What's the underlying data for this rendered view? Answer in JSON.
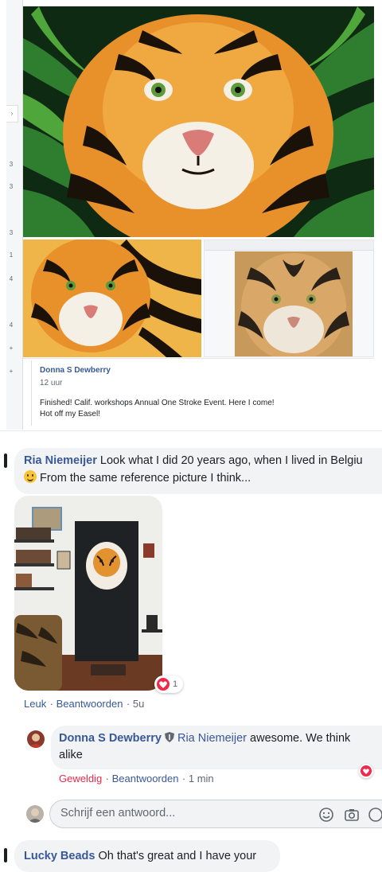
{
  "sidebar": {
    "markers": [
      "3",
      "3",
      "3",
      "1",
      "4",
      "4",
      "+",
      "+"
    ]
  },
  "post": {
    "author": "Donna S Dewberry",
    "time": "12 uur",
    "text_line1": "Finished! Calif. workshops Annual One Stroke Event. Here I come!",
    "text_line2": "Hot off my Easel!"
  },
  "comments": {
    "ria": {
      "name": "Ria Niemeijer",
      "text_line1": "Look what I did 20 years ago, when I lived in Belgiu",
      "text_line2": "From the same reference picture I think...",
      "reaction_count": "1",
      "like": "Leuk",
      "reply": "Beantwoorden",
      "time": "5u"
    },
    "donna_reply": {
      "name": "Donna S Dewberry",
      "mention": "Ria Niemeijer",
      "text_line1": "awesome. We think",
      "text_line2": "alike",
      "reaction": "Geweldig",
      "reply": "Beantwoorden",
      "time": "1 min"
    },
    "lucky": {
      "name": "Lucky Beads",
      "text": "Oh that's great and I have your"
    }
  },
  "reply_input": {
    "placeholder": "Schrijf een antwoord..."
  },
  "colors": {
    "link": "#385898",
    "bubble": "#f2f3f5",
    "love": "#f02849",
    "muted": "#606770"
  }
}
